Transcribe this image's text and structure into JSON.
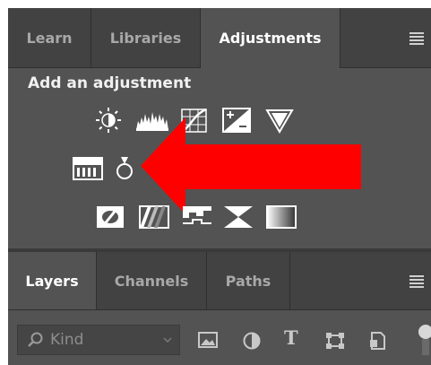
{
  "top_tabs": [
    {
      "label": "Learn",
      "active": false
    },
    {
      "label": "Libraries",
      "active": false
    },
    {
      "label": "Adjustments",
      "active": true
    }
  ],
  "adjustments": {
    "title": "Add an adjustment",
    "row1_icons": [
      "brightness-contrast-icon",
      "levels-icon",
      "curves-icon",
      "exposure-icon",
      "vibrance-icon"
    ],
    "row2_icons": [
      "hue-saturation-icon",
      "color-balance-icon"
    ],
    "row3_icons": [
      "invert-icon",
      "posterize-icon",
      "threshold-icon",
      "selective-color-icon",
      "gradient-map-icon"
    ]
  },
  "bottom_tabs": [
    {
      "label": "Layers",
      "active": true
    },
    {
      "label": "Channels",
      "active": false
    },
    {
      "label": "Paths",
      "active": false
    }
  ],
  "layers": {
    "filter_label": "Kind",
    "type_filter_glyph": "T"
  },
  "colors": {
    "panel_bg": "#535353",
    "tab_bg": "#424242",
    "arrow": "#ff0000"
  }
}
